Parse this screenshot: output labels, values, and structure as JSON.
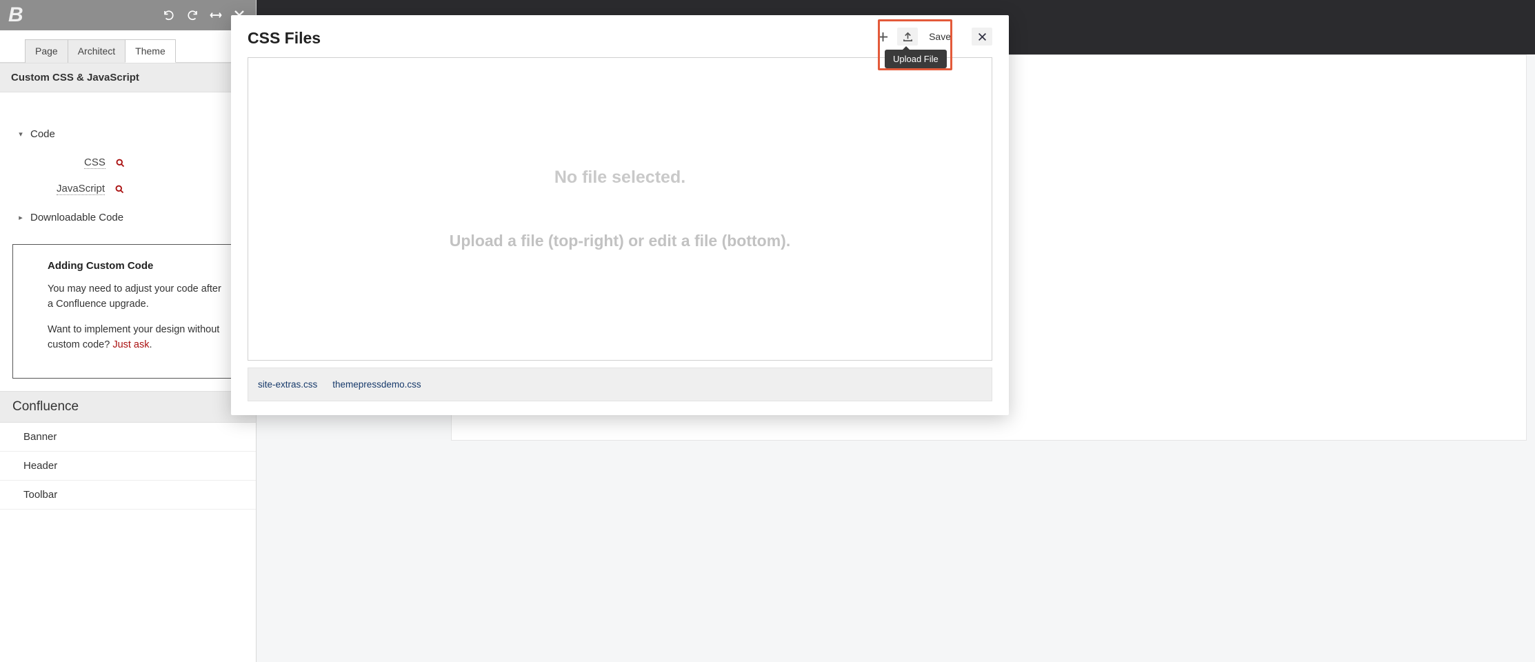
{
  "appbar": {
    "icons": [
      "undo-icon",
      "redo-icon",
      "expand-icon",
      "close-icon"
    ]
  },
  "tabs": {
    "items": [
      {
        "label": "Page",
        "active": false
      },
      {
        "label": "Architect",
        "active": false
      },
      {
        "label": "Theme",
        "active": true
      }
    ]
  },
  "sidebar": {
    "section_title": "Custom CSS & JavaScript",
    "tree": {
      "code_label": "Code",
      "css_label": "CSS",
      "js_label": "JavaScript",
      "downloadable_label": "Downloadable Code"
    },
    "callout": {
      "title": "Adding Custom Code",
      "p1": "You may need to adjust your code after a Confluence upgrade.",
      "p2a": "Want to implement your design without custom code? ",
      "p2_link": "Just ask",
      "p2b": "."
    },
    "confluence": {
      "title": "Confluence",
      "items": [
        "Banner",
        "Header",
        "Toolbar"
      ]
    }
  },
  "dialog": {
    "title": "CSS Files",
    "save_label": "Save",
    "tooltip": "Upload File",
    "dz_line1": "No file selected.",
    "dz_line2": "Upload a file (top-right) or edit a file (bottom).",
    "files": [
      "site-extras.css",
      "themepressdemo.css"
    ]
  }
}
